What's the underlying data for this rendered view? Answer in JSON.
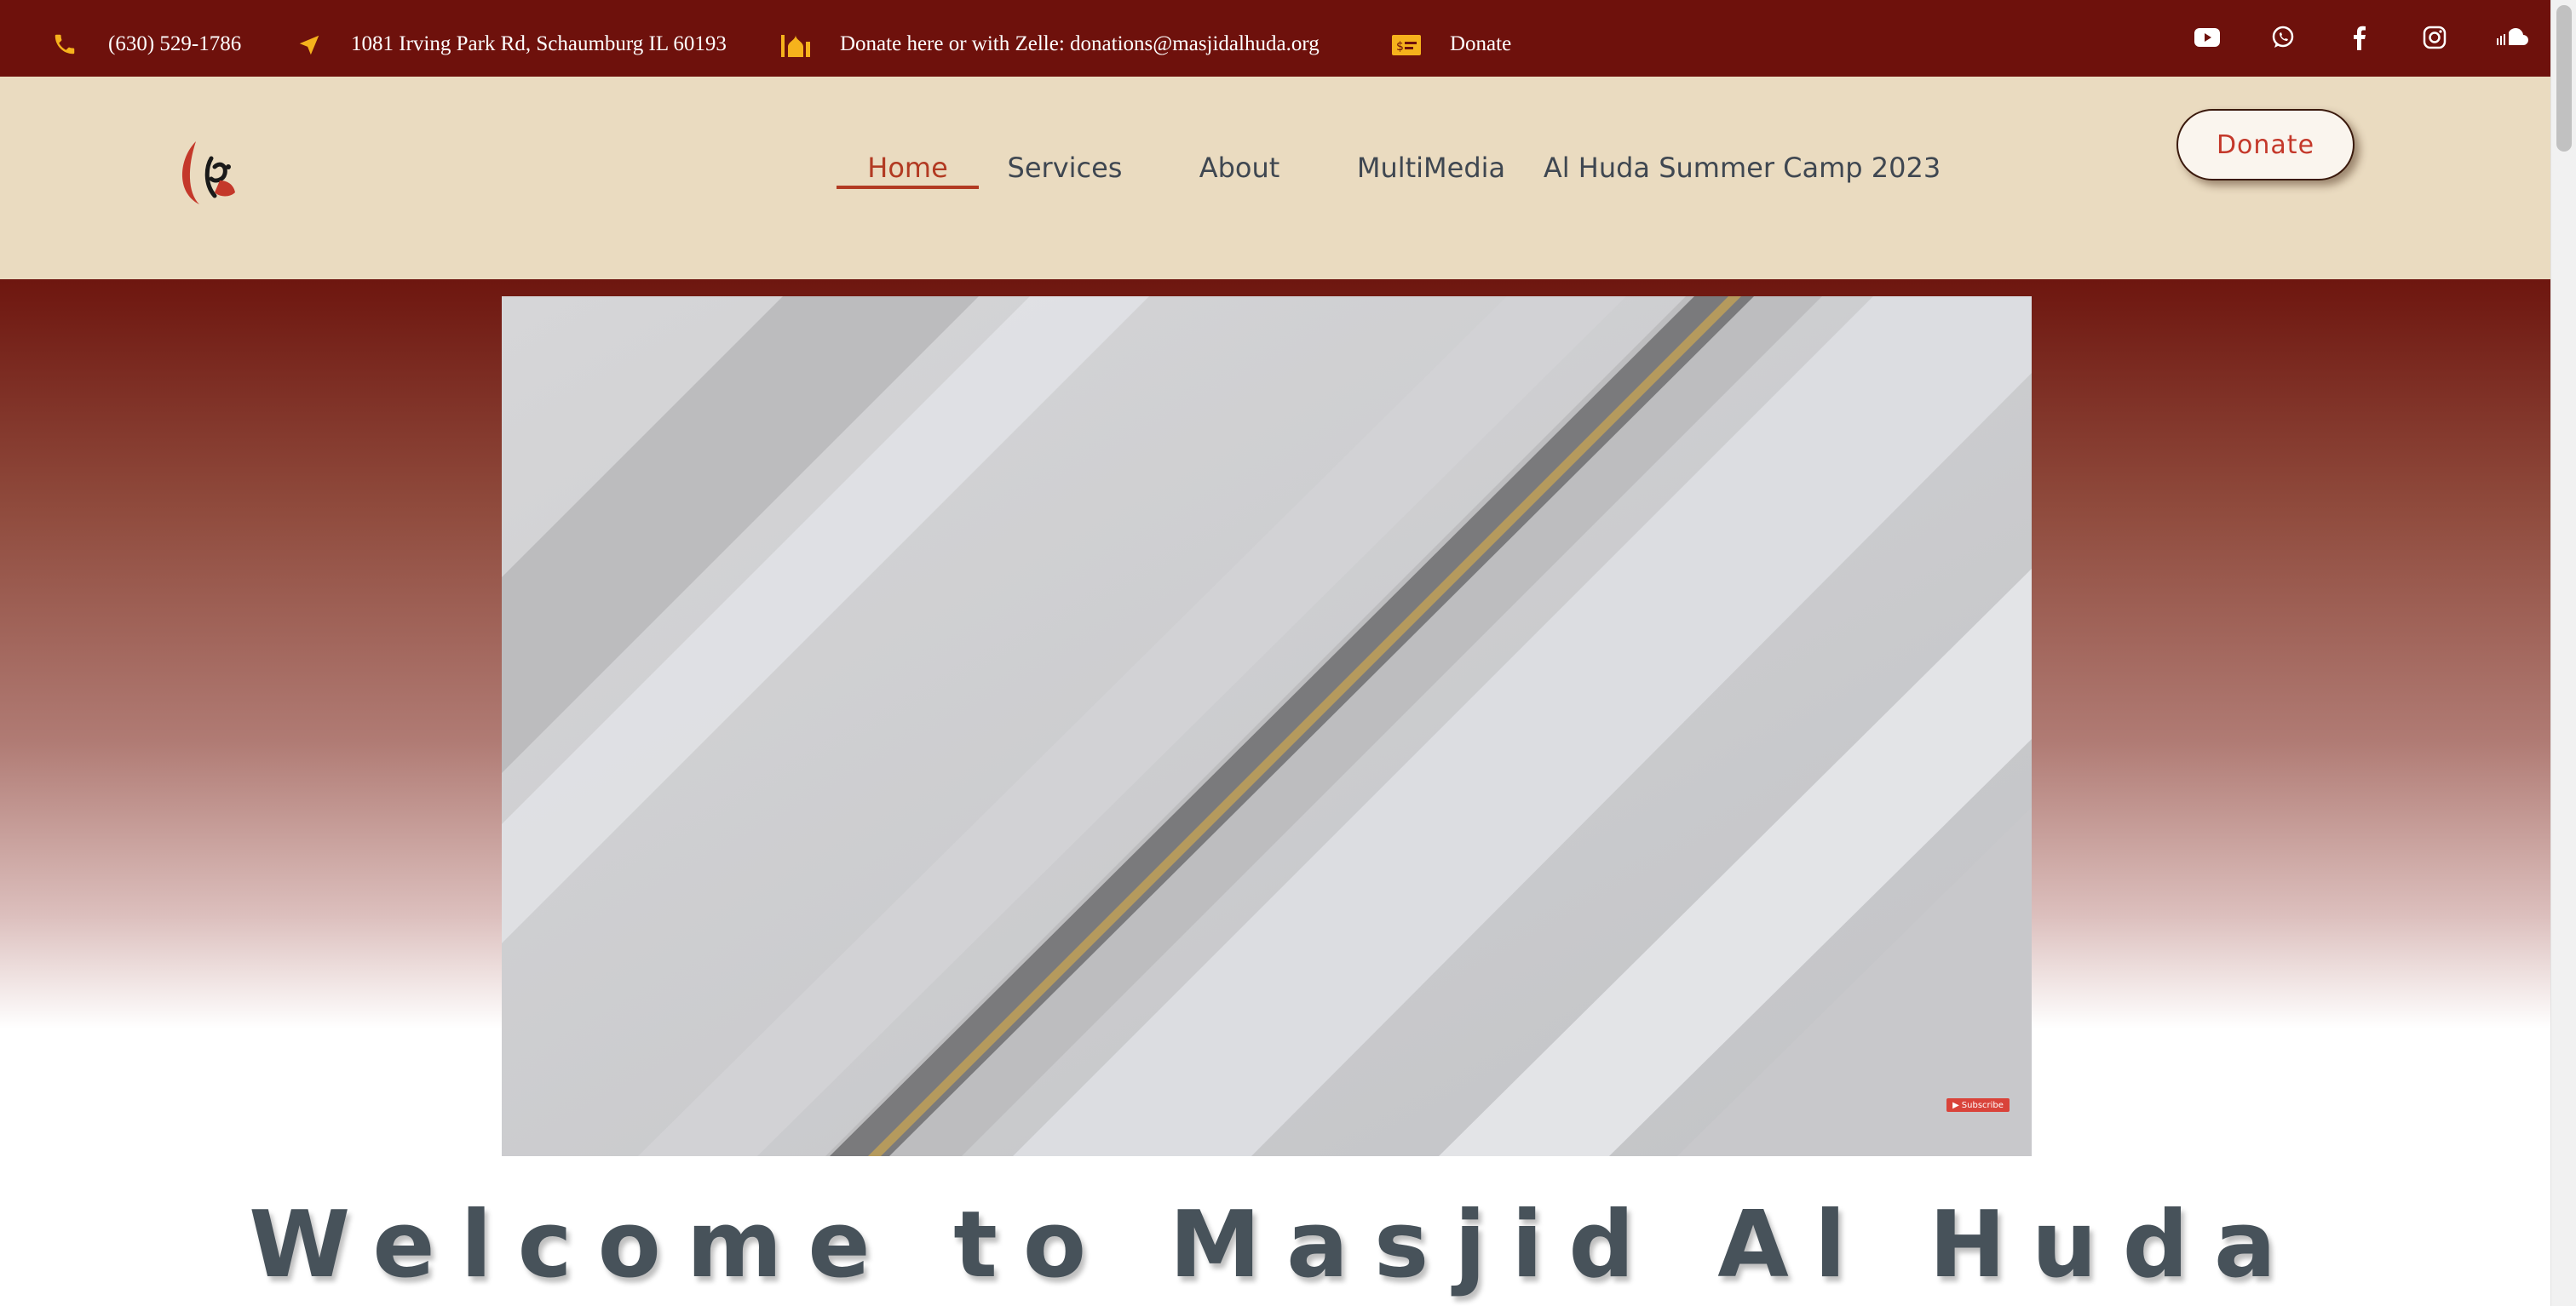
{
  "topbar": {
    "phone": "(630) 529-1786",
    "address": "1081 Irving Park Rd, Schaumburg IL 60193",
    "zelle": "Donate here or with Zelle: donations@masjidalhuda.org",
    "donate_link": "Donate",
    "icon_color": "#f6b21c",
    "social": [
      "youtube-icon",
      "whatsapp-icon",
      "facebook-icon",
      "instagram-icon",
      "soundcloud-icon"
    ]
  },
  "nav": {
    "items": [
      "Home",
      "Services",
      "About",
      "MultiMedia",
      "Al Huda Summer Camp 2023"
    ],
    "active": "Home",
    "donate_button": "Donate"
  },
  "hero": {
    "video_subscribe": "Subscribe",
    "welcome_heading": "Welcome to Masjid Al Huda"
  },
  "colors": {
    "topbar_bg": "#6e110c",
    "header_bg": "#eadbc0",
    "accent": "#b23a22",
    "nav_text": "#3f4751"
  }
}
